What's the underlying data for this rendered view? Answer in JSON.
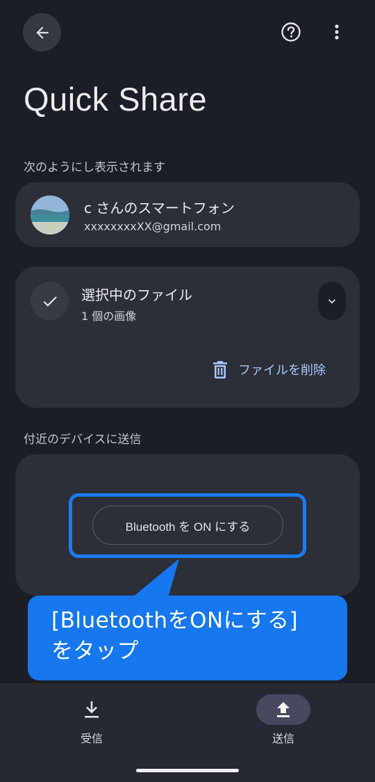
{
  "app": {
    "title": "Quick Share"
  },
  "header": {
    "back_icon": "arrow-back-icon",
    "help_icon": "help-circle-icon",
    "more_icon": "more-vert-icon"
  },
  "visibility": {
    "label": "次のようにし表示されます",
    "profile_name": "c さんのスマートフォン",
    "profile_email": "xxxxxxxxXX@gmail.com"
  },
  "files": {
    "title": "選択中のファイル",
    "subtitle": "1 個の画像",
    "delete_label": "ファイルを削除"
  },
  "nearby": {
    "label": "付近のデバイスに送信",
    "bluetooth_button": "Bluetooth を ON にする"
  },
  "callout": {
    "line1": "[BluetoothをONにする]",
    "line2": "をタップ"
  },
  "bottom_nav": {
    "receive_label": "受信",
    "send_label": "送信"
  },
  "colors": {
    "background": "#1b1e26",
    "card": "#2c2f38",
    "accent_link": "#a9c7ff",
    "highlight": "#1a7bf0",
    "callout": "#1677ee"
  }
}
